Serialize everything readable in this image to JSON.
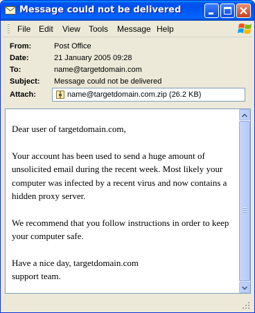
{
  "window": {
    "title": "Message could not be delivered"
  },
  "menu": {
    "items": [
      "File",
      "Edit",
      "View",
      "Tools",
      "Message",
      "Help"
    ]
  },
  "header": {
    "from_label": "From:",
    "from_value": "Post Office",
    "date_label": "Date:",
    "date_value": "21 January 2005 09:28",
    "to_label": "To:",
    "to_value": "name@targetdomain.com",
    "subject_label": "Subject:",
    "subject_value": "Message could not be delivered",
    "attach_label": "Attach:",
    "attachment": "name@targetdomain.com.zip (26.2 KB)"
  },
  "body": {
    "paragraphs": [
      "Dear user of targetdomain.com,",
      "Your account has been used to send a huge amount of unsolicited email during the recent week. Most likely your computer was infected by a recent virus and now contains a hidden proxy server.",
      "We recommend that you follow instructions in order to keep your computer safe.",
      "Have a nice day, targetdomain.com support team."
    ]
  },
  "colors": {
    "titlebar": "#0053ee",
    "chrome": "#ece9d8",
    "close_button": "#c7401f"
  }
}
